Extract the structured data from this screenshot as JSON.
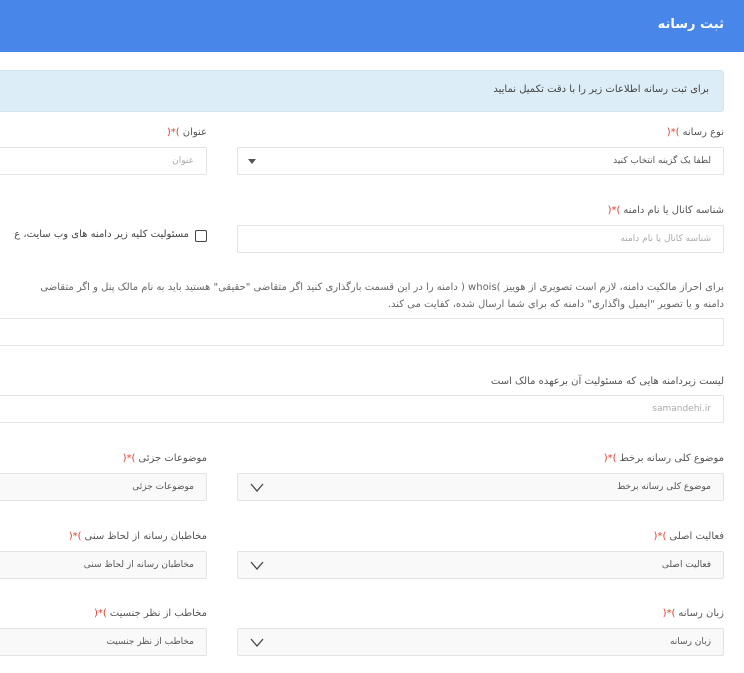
{
  "header": {
    "title": "ثبت رسانه"
  },
  "alert": {
    "text": "برای ثبت رسانه اطلاعات زیر را با دقت تکمیل نمایید"
  },
  "required_marker": ")*(",
  "fields": {
    "media_type": {
      "label": "نوع رسانه",
      "value": "لطفا یک گزینه انتخاب کنید"
    },
    "title": {
      "label": "عنوان",
      "placeholder": "عنوان"
    },
    "channel_id": {
      "label": "شناسه کانال یا نام دامنه",
      "placeholder": "شناسه کانال یا نام دامنه"
    },
    "subdomain_checkbox": {
      "label": "مسئولیت کلیه زیر دامنه های وب سایت، ع",
      "checked": false
    },
    "ownership_note": {
      "line1": "برای احراز مالکیت دامنه، لازم است تصویری از هوییز )whois ( دامنه را در این قسمت بارگذاری کنید اگر متقاضی \"حقیقی\" هستید باید به نام مالک پنل و اگر متقاضی",
      "line2": "دامنه و یا تصویر \"ایمیل واگذاری\" دامنه که برای شما ارسال شده، کفایت می کند."
    },
    "subdomains": {
      "label": "لیست زیردامنه هایی که مسئولیت آن برعهده مالک است",
      "placeholder": "samandehi.ir"
    },
    "general_topic": {
      "label": "موضوع کلی رسانه برخط",
      "value": "موضوع کلی رسانه برخط"
    },
    "sub_topics": {
      "label": "موضوعات جزئی",
      "value": "موضوعات جزئی"
    },
    "main_activity": {
      "label": "فعالیت اصلی",
      "value": "فعالیت اصلی"
    },
    "age_audience": {
      "label": "مخاطبان رسانه از لحاظ سنی",
      "value": "مخاطبان رسانه از لحاظ سنی"
    },
    "language": {
      "label": "زبان رسانه",
      "value": "زبان رسانه"
    },
    "gender_audience": {
      "label": "مخاطب از نظر جنسیت",
      "value": "مخاطب از نظر جنسیت"
    }
  },
  "colors": {
    "header": "#4886ea",
    "alert_bg": "#dcedf7",
    "required": "#e0412f"
  }
}
